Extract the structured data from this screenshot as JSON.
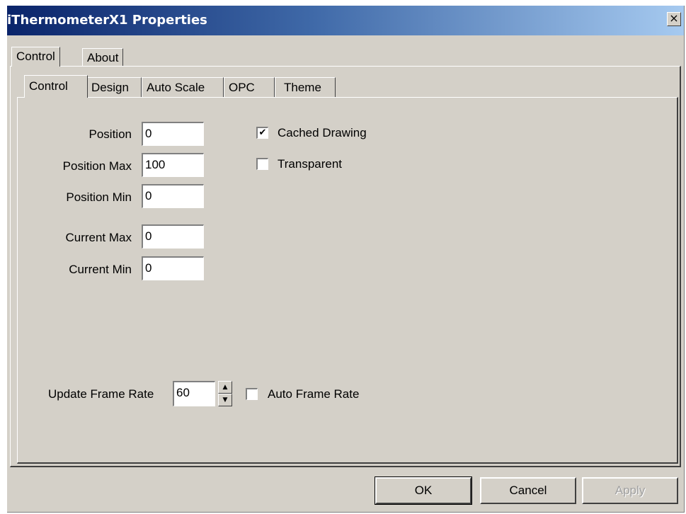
{
  "window": {
    "title": "iThermometerX1 Properties",
    "close_glyph": "×"
  },
  "outer_tabs": [
    {
      "label": "Control"
    },
    {
      "label": "About"
    }
  ],
  "inner_tabs": [
    {
      "label": "Control"
    },
    {
      "label": "Design"
    },
    {
      "label": "Auto Scale"
    },
    {
      "label": "OPC"
    },
    {
      "label": "Theme"
    }
  ],
  "fields": {
    "position": {
      "label": "Position",
      "value": "0"
    },
    "position_max": {
      "label": "Position Max",
      "value": "100"
    },
    "position_min": {
      "label": "Position Min",
      "value": "0"
    },
    "current_max": {
      "label": "Current Max",
      "value": "0"
    },
    "current_min": {
      "label": "Current Min",
      "value": "0"
    }
  },
  "checkboxes": {
    "cached_drawing": {
      "label": "Cached Drawing",
      "checked": true
    },
    "transparent": {
      "label": "Transparent",
      "checked": false
    },
    "auto_frame_rate": {
      "label": "Auto Frame Rate",
      "checked": false
    }
  },
  "frame_rate": {
    "label": "Update Frame Rate",
    "value": "60"
  },
  "buttons": {
    "ok": "OK",
    "cancel": "Cancel",
    "apply": "Apply"
  },
  "icons": {
    "check": "✔",
    "spin_up": "▲",
    "spin_down": "▼"
  },
  "colors": {
    "face": "#d4d0c8",
    "title_start": "#0a246a",
    "title_end": "#a6caf0",
    "disabled_text": "#a0a0a0"
  }
}
